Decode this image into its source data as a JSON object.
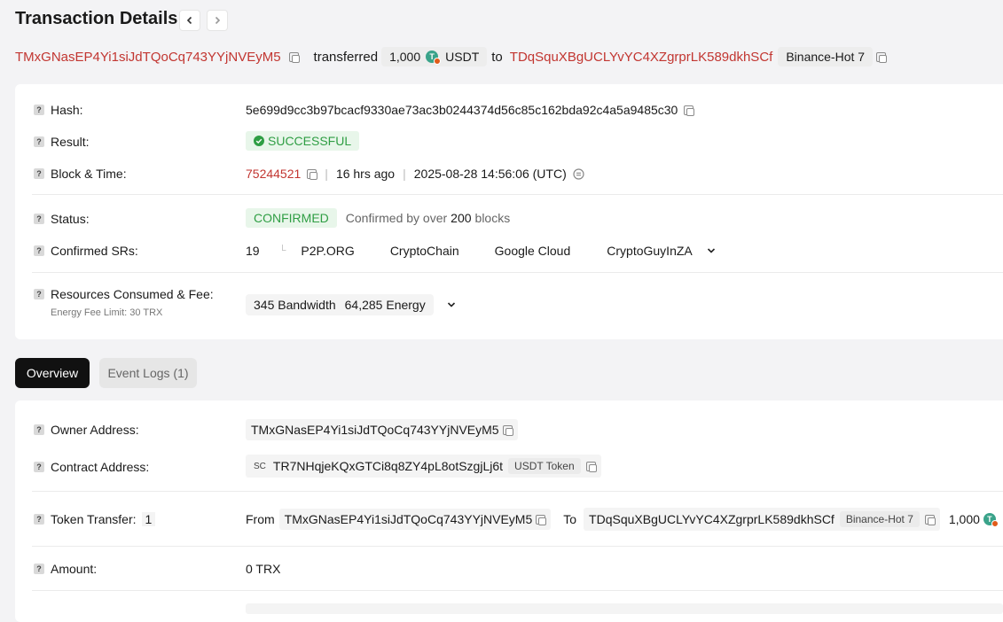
{
  "title": "Transaction Details",
  "summary": {
    "from": "TMxGNasEP4Yi1siJdTQoCq743YYjNVEyM5",
    "verb": "transferred",
    "amount": "1,000",
    "token": "USDT",
    "to_word": "to",
    "to": "TDqSquXBgUCLYvYC4XZgrprLK589dkhSCf",
    "to_label": "Binance-Hot 7"
  },
  "details": {
    "hash_label": "Hash:",
    "hash": "5e699d9cc3b97bcacf9330ae73ac3b0244374d56c85c162bda92c4a5a9485c30",
    "result_label": "Result:",
    "result": "SUCCESSFUL",
    "block_label": "Block & Time:",
    "block": "75244521",
    "age": "16 hrs ago",
    "time": "2025-08-28 14:56:06 (UTC)",
    "status_label": "Status:",
    "status": "CONFIRMED",
    "confirm_prefix": "Confirmed by over",
    "confirm_count": "200",
    "confirm_suffix": "blocks",
    "srs_label": "Confirmed SRs:",
    "srs_count": "19",
    "srs": [
      "P2P.ORG",
      "CryptoChain",
      "Google Cloud",
      "CryptoGuyInZA"
    ],
    "resources_label": "Resources Consumed & Fee:",
    "fee_limit": "Energy Fee Limit: 30 TRX",
    "bandwidth": "345 Bandwidth",
    "energy": "64,285 Energy"
  },
  "tabs": {
    "overview": "Overview",
    "event_logs": "Event Logs (1)"
  },
  "overview": {
    "owner_label": "Owner Address:",
    "owner": "TMxGNasEP4Yi1siJdTQoCq743YYjNVEyM5",
    "contract_label": "Contract Address:",
    "contract_prefix": "SC",
    "contract": "TR7NHqjeKQxGTCi8q8ZY4pL8otSzgjLj6t",
    "contract_tag": "USDT Token",
    "transfer_label": "Token Transfer:",
    "transfer_count": "1",
    "from_word": "From",
    "transfer_from": "TMxGNasEP4Yi1siJdTQoCq743YYjNVEyM5",
    "to_word": "To",
    "transfer_to": "TDqSquXBgUCLYvYC4XZgrprLK589dkhSCf",
    "transfer_to_tag": "Binance-Hot 7",
    "transfer_amount": "1,000",
    "amount_label": "Amount:",
    "amount": "0 TRX"
  },
  "colors": {
    "accent": "#c23631",
    "success": "#2f9e44",
    "tab_active": "#111111"
  }
}
